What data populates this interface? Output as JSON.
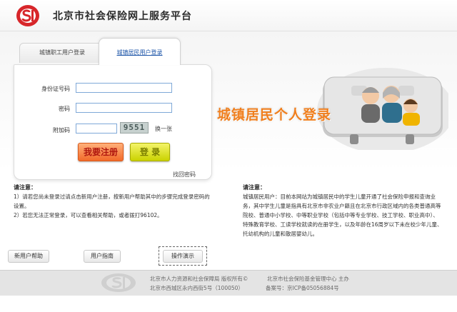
{
  "header": {
    "site_title": "北京市社会保险网上服务平台"
  },
  "tabs": {
    "employee_login": "城镇职工用户登录",
    "resident_login": "城镇居民用户登录"
  },
  "form": {
    "id_label": "身份证号码",
    "password_label": "密码",
    "captcha_label": "附加码",
    "captcha_value": "9551",
    "refresh_captcha": "换一张",
    "register_button": "我要注册",
    "login_button": "登 录",
    "forgot_password": "找回密码"
  },
  "promo": {
    "title": "城镇居民个人登录"
  },
  "notice_left": {
    "title": "请注意：",
    "lines": [
      "1）请若您尚未登录过请点击新用户注册，按新用户帮助其中的步骤完成登录密码的",
      "设置。",
      "2）若您无法正常登录，可以查看相关帮助，或者拨打96102。"
    ]
  },
  "notice_right": {
    "title": "请注意：",
    "lines": [
      "城镇居民用户：目前本网站为城镇居民中的学生儿童开通了社会保险申报和查询业",
      "务，其中学生儿童是指具有北京市非农业户籍且在北京市行政区域内的各类普通高等",
      "院校、普通中小学校、中等职业学校（包括中等专业学校、技工学校、职业高中）、",
      "特殊教育学校、工读学校就读的在册学生，以及年龄在16周岁以下未在校少年儿童、",
      "托幼机构的儿童和散居婴幼儿。"
    ]
  },
  "bottom_buttons": {
    "new_user_help": "新用户帮助",
    "user_guide": "用户指南",
    "demo": "操作演示"
  },
  "footer": {
    "line1_left": "北京市人力资源和社会保障局  版权所有©",
    "line1_right": "北京市社会保险基金管理中心  主办",
    "line2_left": "北京市西城区永内西街5号（100050）",
    "line2_right": "备案号：京ICP备05056884号"
  },
  "colors": {
    "brand_red": "#d7262a",
    "link_blue": "#1d55a8",
    "promo_orange": "#f07f1e",
    "register_orange": "#f26a2a",
    "login_yellow": "#cad200"
  },
  "icons": {
    "logo": "si-logo",
    "illustration": "family-rolodex-illustration"
  }
}
